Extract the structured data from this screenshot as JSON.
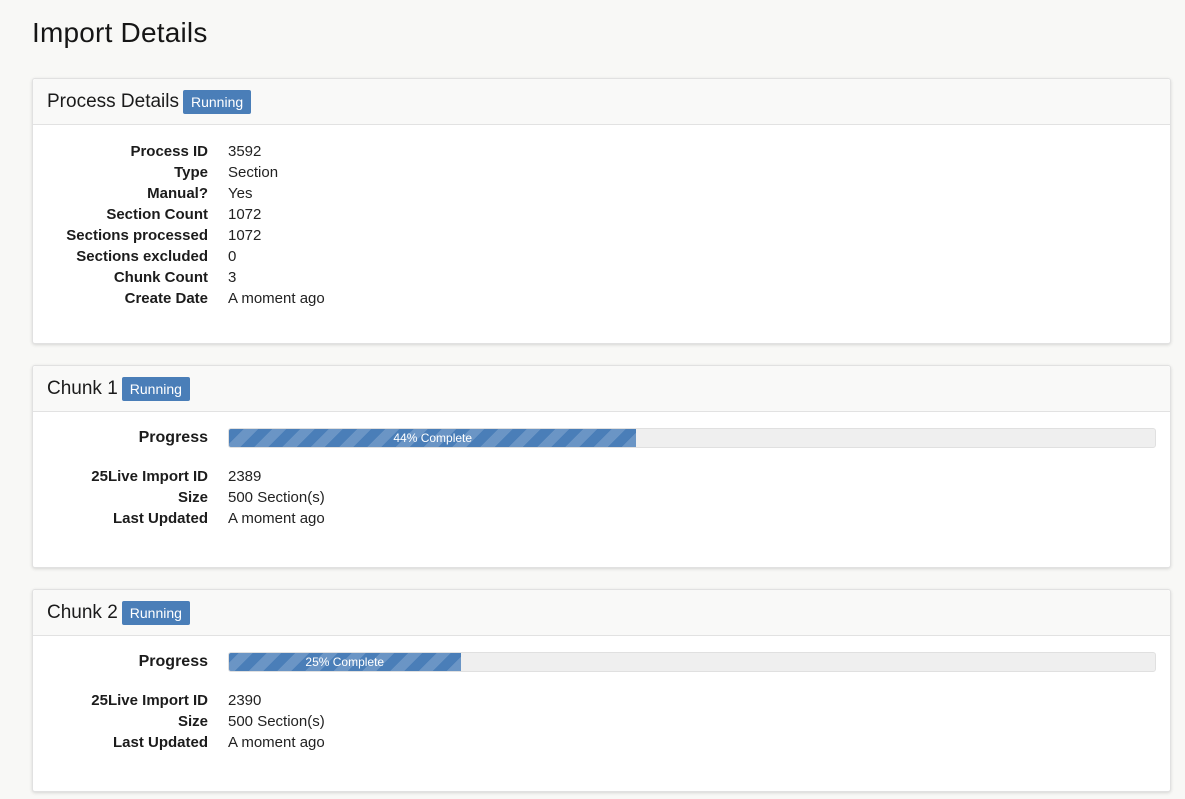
{
  "page": {
    "title": "Import Details"
  },
  "colors": {
    "accent": "#4a7eb8",
    "progress_track": "#efefef"
  },
  "process": {
    "title": "Process Details",
    "status": "Running",
    "fields": [
      {
        "label": "Process ID",
        "value": "3592"
      },
      {
        "label": "Type",
        "value": "Section"
      },
      {
        "label": "Manual?",
        "value": "Yes"
      },
      {
        "label": "Section Count",
        "value": "1072"
      },
      {
        "label": "Sections processed",
        "value": "1072"
      },
      {
        "label": "Sections excluded",
        "value": "0"
      },
      {
        "label": "Chunk Count",
        "value": "3"
      },
      {
        "label": "Create Date",
        "value": "A moment ago"
      }
    ]
  },
  "chunks": [
    {
      "title": "Chunk 1",
      "status": "Running",
      "progress_label": "Progress",
      "progress_percent": 44,
      "progress_text": "44% Complete",
      "fields": [
        {
          "label": "25Live Import ID",
          "value": "2389"
        },
        {
          "label": "Size",
          "value": "500 Section(s)"
        },
        {
          "label": "Last Updated",
          "value": "A moment ago"
        }
      ]
    },
    {
      "title": "Chunk 2",
      "status": "Running",
      "progress_label": "Progress",
      "progress_percent": 25,
      "progress_text": "25% Complete",
      "fields": [
        {
          "label": "25Live Import ID",
          "value": "2390"
        },
        {
          "label": "Size",
          "value": "500 Section(s)"
        },
        {
          "label": "Last Updated",
          "value": "A moment ago"
        }
      ]
    }
  ]
}
